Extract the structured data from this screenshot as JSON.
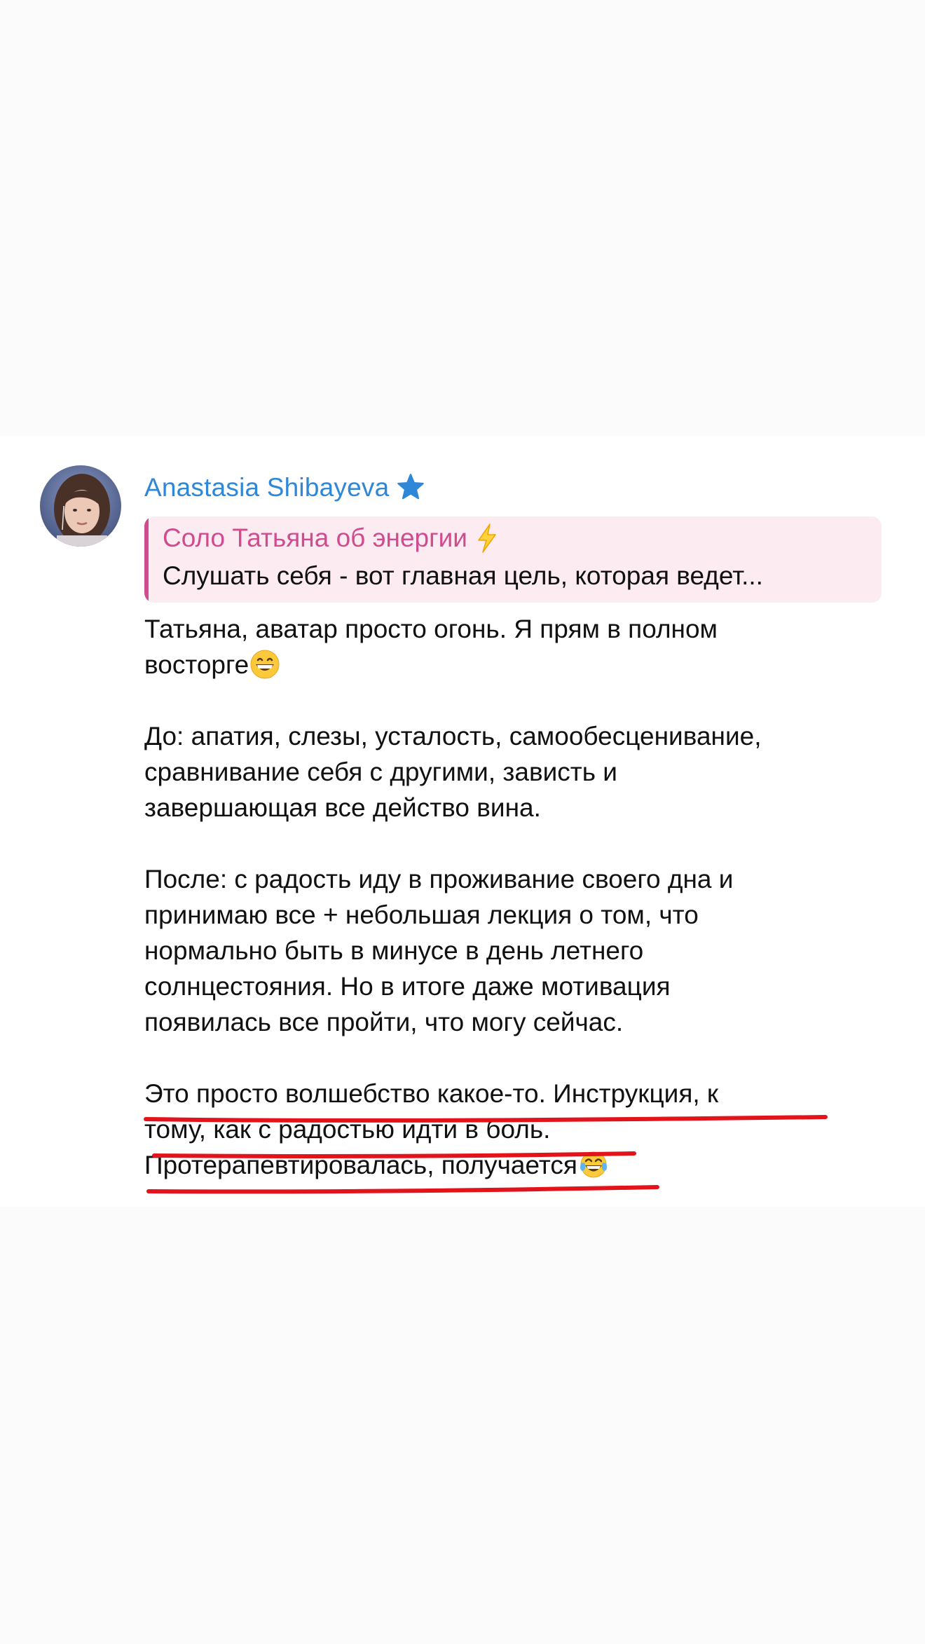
{
  "message": {
    "author_name": "Anastasia Shibayeva",
    "author_badge_icon": "star-icon",
    "reply": {
      "title": "Соло Татьяна об энергии",
      "title_icon": "lightning-icon",
      "snippet": "Слушать себя - вот главная цель, которая ведет..."
    },
    "paragraphs": [
      {
        "lines": [
          "Татьяна, аватар просто огонь. Я прям в полном",
          "восторге"
        ],
        "trailing_emoji": "grinning-face-icon"
      },
      {
        "lines": [
          "До: апатия, слезы, усталость, самообесценивание,",
          "сравнивание себя с другими, зависть и",
          "завершающая все действо вина."
        ]
      },
      {
        "lines": [
          "После: с радость иду в проживание своего дна и",
          "принимаю все + небольшая лекция о том, что",
          "нормально быть в минусе в день летнего",
          "солнцестояния. Но в итоге даже мотивация",
          "появилась все пройти, что могу сейчас."
        ]
      },
      {
        "lines": [
          "Это просто волшебство какое-то. Инструкция, к",
          "тому, как с радостью идти в боль.",
          "Протерапевтировалась, получается"
        ],
        "trailing_emoji": "tears-of-joy-icon"
      }
    ]
  },
  "colors": {
    "page_background": "#fbfbfc",
    "card_background": "#ffffff",
    "author_name": "#2f87d8",
    "reply_accent": "#d14b8f",
    "reply_background": "#fcecf2",
    "text": "#111111",
    "underline_marker": "#e3131b"
  }
}
